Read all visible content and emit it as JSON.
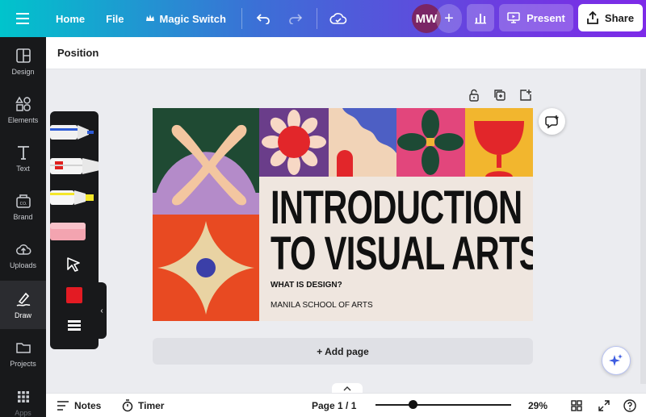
{
  "topbar": {
    "home": "Home",
    "file": "File",
    "magic_switch": "Magic Switch",
    "avatar_initials": "MW",
    "add_collaborator": "+",
    "present": "Present",
    "share": "Share"
  },
  "sidebar": {
    "items": [
      {
        "label": "Design",
        "icon": "layout-icon"
      },
      {
        "label": "Elements",
        "icon": "shapes-icon"
      },
      {
        "label": "Text",
        "icon": "text-icon"
      },
      {
        "label": "Brand",
        "icon": "brand-icon"
      },
      {
        "label": "Uploads",
        "icon": "cloud-upload-icon"
      },
      {
        "label": "Draw",
        "icon": "draw-icon",
        "active": true
      },
      {
        "label": "Projects",
        "icon": "folder-icon"
      },
      {
        "label": "Apps",
        "icon": "apps-grid-icon"
      }
    ]
  },
  "position_bar": {
    "label": "Position"
  },
  "draw_panel": {
    "tools": [
      "pen",
      "marker",
      "highlighter",
      "eraser",
      "select"
    ],
    "current_color": "#e31b23"
  },
  "slide": {
    "title_line1": "INTRODUCTION",
    "title_line2": "TO VISUAL ARTS",
    "subtitle": "WHAT IS DESIGN?",
    "school": "MANILA SCHOOL OF ARTS"
  },
  "add_page": {
    "label": "+ Add page"
  },
  "bottombar": {
    "notes": "Notes",
    "timer": "Timer",
    "page_indicator": "Page 1 / 1",
    "zoom": "29%"
  },
  "colors": {
    "sidebar_bg": "#18191b",
    "canvas_bg": "#ebecf0",
    "accent_purple": "#7d2ae8",
    "accent_teal": "#00c4cc"
  }
}
